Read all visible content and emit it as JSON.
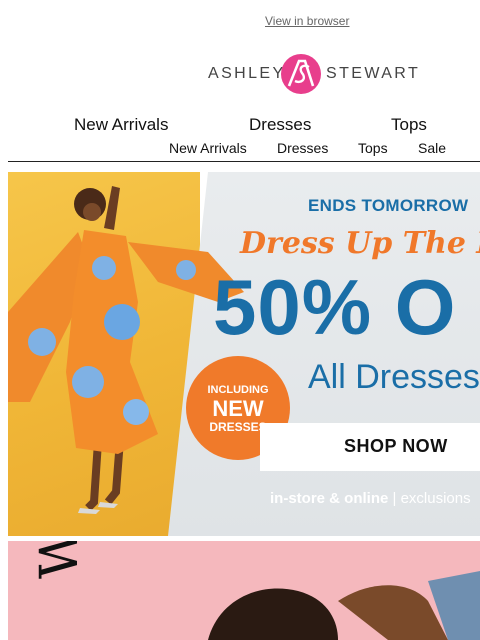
{
  "preheader": {
    "view_in_browser": "View in browser"
  },
  "brand": {
    "left": "ASHLEY",
    "right": "STEWART",
    "accent": "#e83e8c"
  },
  "nav": {
    "main": [
      "New Arrivals",
      "Dresses",
      "Tops"
    ],
    "sub": [
      "New Arrivals",
      "Dresses",
      "Tops",
      "Sale"
    ]
  },
  "hero": {
    "ends_text": "ENDS TOMORROW",
    "script_text": "Dress Up The Mo",
    "offer_text": "50% O",
    "category_text": "All Dresses",
    "badge_line1": "INCLUDING",
    "badge_line2": "NEW",
    "badge_line3": "DRESSES",
    "cta_label": "SHOP NOW",
    "footer_bold": "in-store & online",
    "footer_rest": " | exclusions"
  },
  "hero2": {
    "vertical_text": "W"
  }
}
